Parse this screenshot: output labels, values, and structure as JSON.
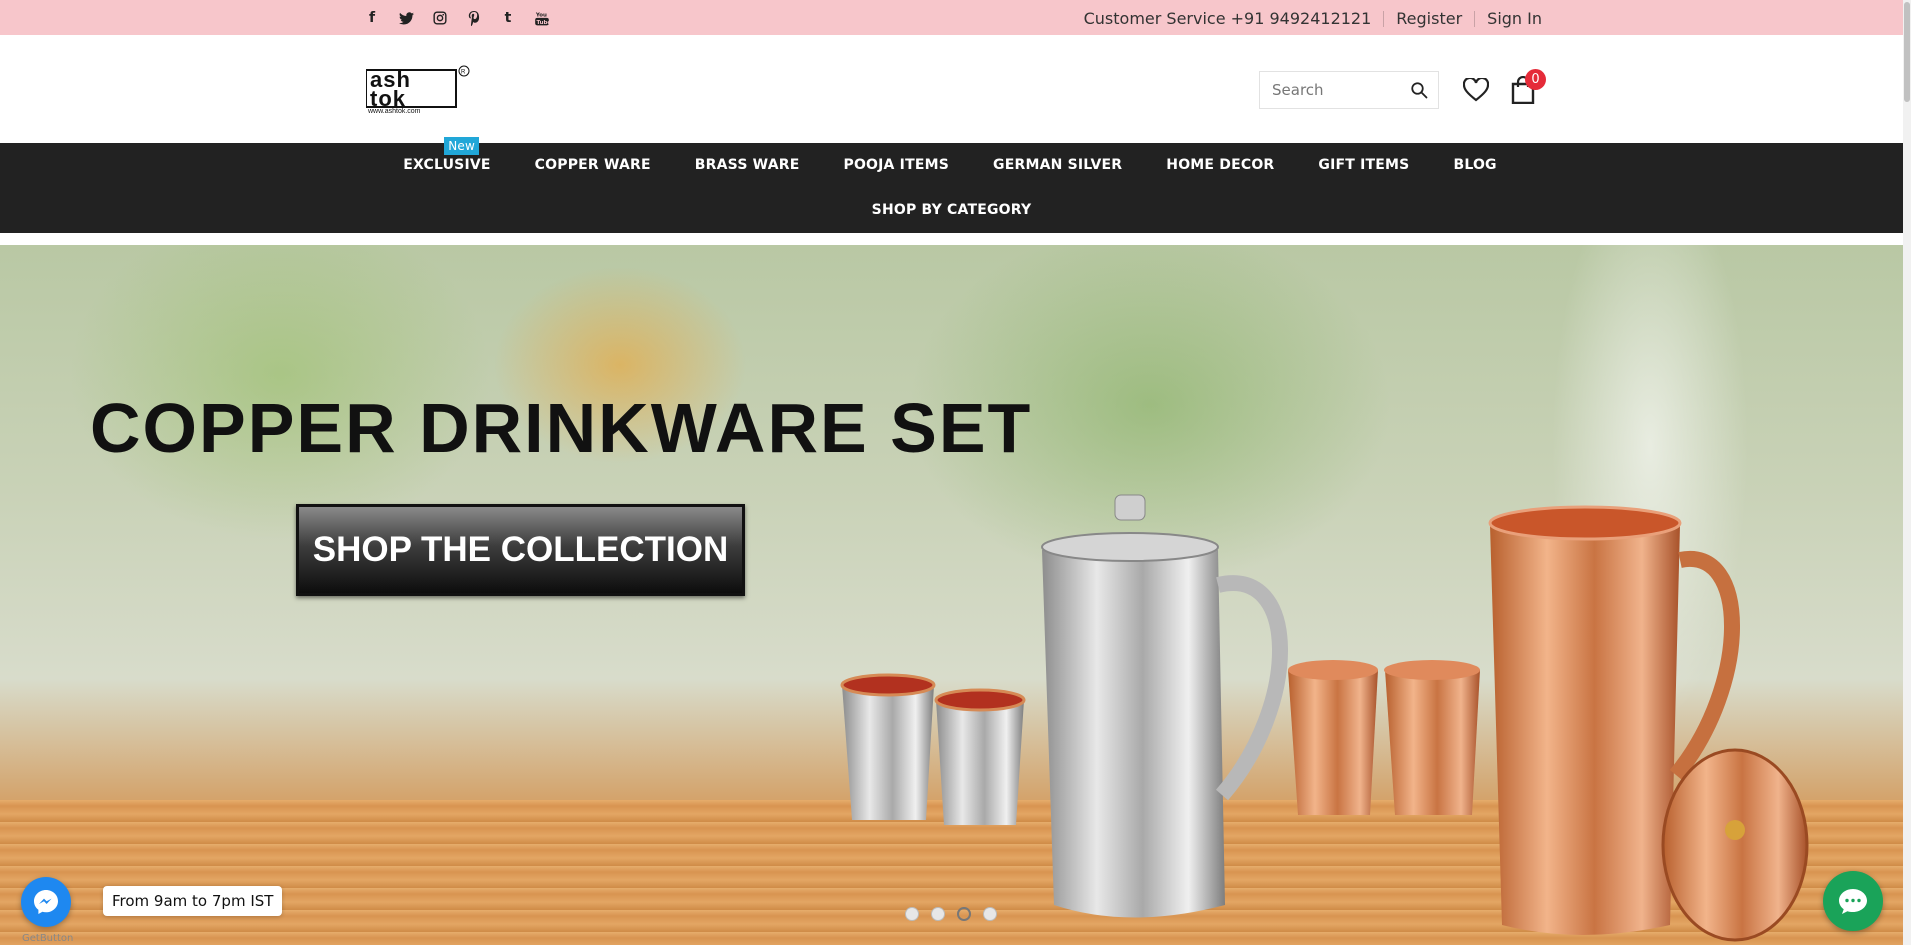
{
  "topbar": {
    "social_icons": [
      "facebook-icon",
      "twitter-icon",
      "instagram-icon",
      "pinterest-icon",
      "tumblr-icon",
      "youtube-icon"
    ],
    "customer_service": "Customer Service +91 9492412121",
    "register": "Register",
    "sign_in": "Sign In",
    "bg_color": "#f7c6cb"
  },
  "header": {
    "logo_line1": "ash",
    "logo_line2": "tok",
    "logo_url_text": "www.ashtok.com",
    "search_placeholder": "Search",
    "cart_count": "0"
  },
  "nav": {
    "items": [
      {
        "label": "EXCLUSIVE",
        "badge": "New"
      },
      {
        "label": "COPPER WARE"
      },
      {
        "label": "BRASS WARE"
      },
      {
        "label": "POOJA ITEMS"
      },
      {
        "label": "GERMAN SILVER"
      },
      {
        "label": "HOME DECOR"
      },
      {
        "label": "GIFT ITEMS"
      },
      {
        "label": "BLOG"
      }
    ],
    "row2": "SHOP BY CATEGORY"
  },
  "hero": {
    "title": "COPPER DRINKWARE SET",
    "button": "SHOP THE COLLECTION",
    "slides": 4,
    "active_slide": 3
  },
  "widgets": {
    "messenger_label": "From 9am to 7pm IST",
    "getbutton": "GetButton"
  }
}
